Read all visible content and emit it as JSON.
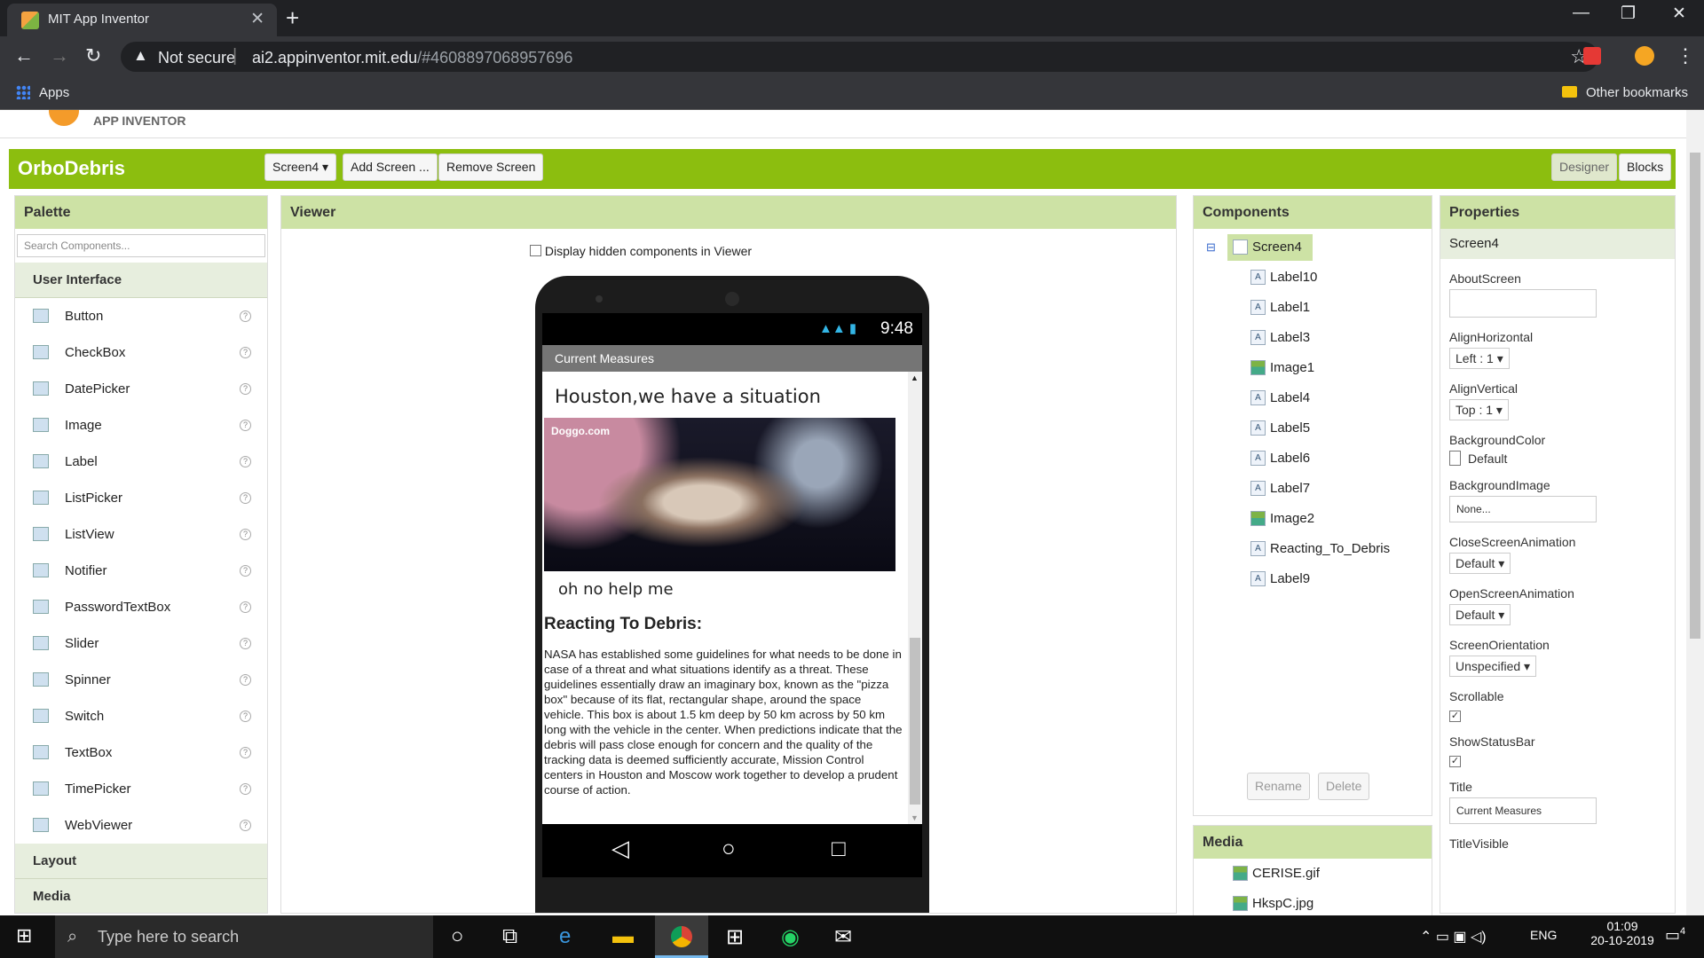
{
  "browser": {
    "tab_title": "MIT App Inventor",
    "not_secure": "Not secure",
    "url_host": "ai2.appinventor.mit.edu",
    "url_path": "/#4608897068957696",
    "bookmarks": {
      "apps": "Apps",
      "other": "Other bookmarks"
    }
  },
  "app": {
    "brand": "APP INVENTOR",
    "project_name": "OrboDebris",
    "screen_select": "Screen4 ▾",
    "add_screen": "Add Screen ...",
    "remove_screen": "Remove Screen",
    "designer": "Designer",
    "blocks": "Blocks"
  },
  "palette": {
    "title": "Palette",
    "search_placeholder": "Search Components...",
    "ui_header": "User Interface",
    "items": [
      {
        "label": "Button",
        "icon": "button-icon"
      },
      {
        "label": "CheckBox",
        "icon": "checkbox-icon"
      },
      {
        "label": "DatePicker",
        "icon": "datepicker-icon"
      },
      {
        "label": "Image",
        "icon": "image-icon"
      },
      {
        "label": "Label",
        "icon": "label-icon"
      },
      {
        "label": "ListPicker",
        "icon": "listpicker-icon"
      },
      {
        "label": "ListView",
        "icon": "listview-icon"
      },
      {
        "label": "Notifier",
        "icon": "notifier-icon"
      },
      {
        "label": "PasswordTextBox",
        "icon": "passwordtextbox-icon"
      },
      {
        "label": "Slider",
        "icon": "slider-icon"
      },
      {
        "label": "Spinner",
        "icon": "spinner-icon"
      },
      {
        "label": "Switch",
        "icon": "switch-icon"
      },
      {
        "label": "TextBox",
        "icon": "textbox-icon"
      },
      {
        "label": "TimePicker",
        "icon": "timepicker-icon"
      },
      {
        "label": "WebViewer",
        "icon": "webviewer-icon"
      }
    ],
    "layout_header": "Layout",
    "media_header": "Media"
  },
  "viewer": {
    "title": "Viewer",
    "hidden_checkbox": "Display hidden components in Viewer",
    "time": "9:48",
    "screen_title": "Current Measures",
    "heading": "Houston,we have a situation",
    "image_watermark": "Doggo.com",
    "caption": "oh no help me",
    "section_title": "Reacting To Debris:",
    "body": "NASA has established some guidelines for what needs to be done in case of a threat and what situations identify as a threat. These guidelines essentially draw an imaginary box, known as the \"pizza box\" because of its flat, rectangular shape, around the space vehicle. This box is about 1.5 km deep by 50 km across by 50 km long with the vehicle in the center. When predictions indicate that the debris will pass close enough for concern and the quality of the tracking data is deemed sufficiently accurate, Mission Control centers in Houston and Moscow work together to develop a prudent course of action."
  },
  "components": {
    "title": "Components",
    "root": "Screen4",
    "items": [
      {
        "label": "Label10",
        "type": "label"
      },
      {
        "label": "Label1",
        "type": "label"
      },
      {
        "label": "Label3",
        "type": "label"
      },
      {
        "label": "Image1",
        "type": "image"
      },
      {
        "label": "Label4",
        "type": "label"
      },
      {
        "label": "Label5",
        "type": "label"
      },
      {
        "label": "Label6",
        "type": "label"
      },
      {
        "label": "Label7",
        "type": "label"
      },
      {
        "label": "Image2",
        "type": "image"
      },
      {
        "label": "Reacting_To_Debris",
        "type": "label"
      },
      {
        "label": "Label9",
        "type": "label"
      }
    ],
    "rename": "Rename",
    "delete": "Delete"
  },
  "media": {
    "title": "Media",
    "items": [
      "CERISE.gif",
      "HkspC.jpg"
    ]
  },
  "properties": {
    "title": "Properties",
    "selected": "Screen4",
    "about_screen": "AboutScreen",
    "align_horizontal": "AlignHorizontal",
    "align_horizontal_value": "Left : 1 ▾",
    "align_vertical": "AlignVertical",
    "align_vertical_value": "Top : 1 ▾",
    "background_color": "BackgroundColor",
    "background_color_value": "Default",
    "background_image": "BackgroundImage",
    "background_image_value": "None...",
    "close_anim": "CloseScreenAnimation",
    "close_anim_value": "Default ▾",
    "open_anim": "OpenScreenAnimation",
    "open_anim_value": "Default ▾",
    "orientation": "ScreenOrientation",
    "orientation_value": "Unspecified ▾",
    "scrollable": "Scrollable",
    "show_status_bar": "ShowStatusBar",
    "title_prop": "Title",
    "title_value": "Current Measures",
    "title_visible": "TitleVisible"
  },
  "taskbar": {
    "search": "Type here to search",
    "lang": "ENG",
    "time": "01:09",
    "date": "20-10-2019",
    "notif": "4"
  }
}
